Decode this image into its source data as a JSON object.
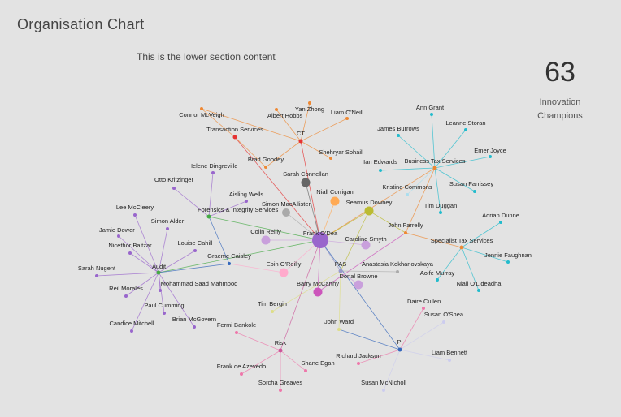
{
  "header": {
    "title": "Organisation Chart",
    "subtitle": "This is the lower section content"
  },
  "kpi": {
    "value": "63",
    "label_line1": "Innovation",
    "label_line2": "Champions"
  },
  "chart_data": {
    "type": "network",
    "nodes": [
      {
        "id": "frank",
        "label": "Frank O'Dea",
        "color": "#9966cc",
        "size": "hub"
      },
      {
        "id": "ct",
        "label": "CT",
        "color": "#e63333",
        "size": "group"
      },
      {
        "id": "ts",
        "label": "Transaction Services",
        "color": "#e63333",
        "size": "group"
      },
      {
        "id": "fis",
        "label": "Forensics & Integrity Services",
        "color": "#44aa44",
        "size": "group"
      },
      {
        "id": "audit",
        "label": "Audit",
        "color": "#44aa44",
        "size": "group"
      },
      {
        "id": "bts",
        "label": "Business Tax Services",
        "color": "#ee8833",
        "size": "group"
      },
      {
        "id": "sts",
        "label": "Specialist Tax Services",
        "color": "#ee8833",
        "size": "group"
      },
      {
        "id": "pas",
        "label": "PAS",
        "color": "#9999cc",
        "size": "group"
      },
      {
        "id": "risk",
        "label": "Risk",
        "color": "#cc5599",
        "size": "group"
      },
      {
        "id": "pi",
        "label": "PI",
        "color": "#3366bb",
        "size": "group"
      },
      {
        "id": "connor",
        "label": "Connor McVeigh",
        "color": "#ee8833"
      },
      {
        "id": "albert",
        "label": "Albert Hobbs",
        "color": "#ee8833"
      },
      {
        "id": "yan",
        "label": "Yan Zhong",
        "color": "#ee8833"
      },
      {
        "id": "liam",
        "label": "Liam O'Neill",
        "color": "#ee8833"
      },
      {
        "id": "shehryar",
        "label": "Shehryar Sohail",
        "color": "#ee8833"
      },
      {
        "id": "brad",
        "label": "Brad Goodey",
        "color": "#ee8833"
      },
      {
        "id": "sarah_c",
        "label": "Sarah Connellan",
        "color": "#666666"
      },
      {
        "id": "helene",
        "label": "Helene Dingreville",
        "color": "#9966cc"
      },
      {
        "id": "otto",
        "label": "Otto Kritzinger",
        "color": "#9966cc"
      },
      {
        "id": "aisling",
        "label": "Aisling Wells",
        "color": "#9966cc"
      },
      {
        "id": "simon_mac",
        "label": "Simon MacAllister",
        "color": "#aaaaaa"
      },
      {
        "id": "niall_c",
        "label": "Niall Corrigan",
        "color": "#ffaa55"
      },
      {
        "id": "seamus",
        "label": "Seamus Downey",
        "color": "#bbbb33"
      },
      {
        "id": "lee",
        "label": "Lee McCleery",
        "color": "#9966cc"
      },
      {
        "id": "simon_a",
        "label": "Simon Alder",
        "color": "#9966cc"
      },
      {
        "id": "jamie_d",
        "label": "Jamie Dower",
        "color": "#9966cc"
      },
      {
        "id": "nicethor",
        "label": "Nicethor Baltzar",
        "color": "#9966cc"
      },
      {
        "id": "louise",
        "label": "Louise Cahill",
        "color": "#9966cc"
      },
      {
        "id": "colin",
        "label": "Colin Reilly",
        "color": "#c9a0dc"
      },
      {
        "id": "caroline",
        "label": "Caroline Smyth",
        "color": "#c9a0dc"
      },
      {
        "id": "graeme",
        "label": "Graeme Caisley",
        "color": "#3366bb"
      },
      {
        "id": "sarah_n",
        "label": "Sarah Nugent",
        "color": "#9966cc"
      },
      {
        "id": "eoin",
        "label": "Eoin O'Reilly",
        "color": "#ffaacc"
      },
      {
        "id": "mohammad",
        "label": "Mohammad Saad Mahmood",
        "color": "#9966cc"
      },
      {
        "id": "reil",
        "label": "Reil Morales",
        "color": "#9966cc"
      },
      {
        "id": "anastasia",
        "label": "Anastasia Kokhanovskaya",
        "color": "#aaaaaa"
      },
      {
        "id": "donal",
        "label": "Donal Browne",
        "color": "#c9a0dc"
      },
      {
        "id": "barry",
        "label": "Barry McCarthy",
        "color": "#cc55bb"
      },
      {
        "id": "paul",
        "label": "Paul Cumming",
        "color": "#9966cc"
      },
      {
        "id": "tim_b",
        "label": "Tim Bergin",
        "color": "#dddd88"
      },
      {
        "id": "brian",
        "label": "Brian McGovern",
        "color": "#9966cc"
      },
      {
        "id": "candice",
        "label": "Candice Mitchell",
        "color": "#9966cc"
      },
      {
        "id": "fermi",
        "label": "Fermi Bankole",
        "color": "#ee77aa"
      },
      {
        "id": "john_w",
        "label": "John Ward",
        "color": "#dddd88"
      },
      {
        "id": "shane",
        "label": "Shane Egan",
        "color": "#ee77aa"
      },
      {
        "id": "frank_a",
        "label": "Frank de Azevedo",
        "color": "#ee77aa"
      },
      {
        "id": "sorcha",
        "label": "Sorcha Greaves",
        "color": "#ee77aa"
      },
      {
        "id": "richard",
        "label": "Richard Jackson",
        "color": "#ee77aa"
      },
      {
        "id": "susan_m",
        "label": "Susan McNicholl",
        "color": "#ccccee"
      },
      {
        "id": "daire",
        "label": "Daire Cullen",
        "color": "#ee77aa"
      },
      {
        "id": "susan_os",
        "label": "Susan O'Shea",
        "color": "#ccccee"
      },
      {
        "id": "liam_b",
        "label": "Liam Bennett",
        "color": "#ccccee"
      },
      {
        "id": "ann",
        "label": "Ann Grant",
        "color": "#22bbcc"
      },
      {
        "id": "leanne",
        "label": "Leanne Storan",
        "color": "#22bbcc"
      },
      {
        "id": "james",
        "label": "James Burrows",
        "color": "#22bbcc"
      },
      {
        "id": "emer",
        "label": "Emer Joyce",
        "color": "#22bbcc"
      },
      {
        "id": "ian",
        "label": "Ian Edwards",
        "color": "#22bbcc"
      },
      {
        "id": "susan_f",
        "label": "Susan Farrissey",
        "color": "#22bbcc"
      },
      {
        "id": "kristine",
        "label": "Kristine Commons",
        "color": "#aaddee"
      },
      {
        "id": "tim_d",
        "label": "Tim Duggan",
        "color": "#22bbcc"
      },
      {
        "id": "john_f",
        "label": "John Farrelly",
        "color": "#ee8833"
      },
      {
        "id": "adrian",
        "label": "Adrian Dunne",
        "color": "#22bbcc"
      },
      {
        "id": "jennie",
        "label": "Jennie Faughnan",
        "color": "#22bbcc"
      },
      {
        "id": "aoife",
        "label": "Aoife Murray",
        "color": "#22bbcc"
      },
      {
        "id": "niall_ol",
        "label": "Niall O'Lideadha",
        "color": "#22bbcc"
      }
    ],
    "edges": [
      [
        "frank",
        "ct"
      ],
      [
        "frank",
        "ts"
      ],
      [
        "frank",
        "fis"
      ],
      [
        "frank",
        "audit"
      ],
      [
        "frank",
        "bts"
      ],
      [
        "frank",
        "pas"
      ],
      [
        "frank",
        "risk"
      ],
      [
        "frank",
        "pi"
      ],
      [
        "frank",
        "sarah_c"
      ],
      [
        "frank",
        "simon_mac"
      ],
      [
        "frank",
        "niall_c"
      ],
      [
        "frank",
        "seamus"
      ],
      [
        "frank",
        "colin"
      ],
      [
        "frank",
        "caroline"
      ],
      [
        "frank",
        "eoin"
      ],
      [
        "frank",
        "barry"
      ],
      [
        "ct",
        "albert"
      ],
      [
        "ct",
        "yan"
      ],
      [
        "ct",
        "liam"
      ],
      [
        "ct",
        "shehryar"
      ],
      [
        "ct",
        "brad"
      ],
      [
        "ct",
        "connor"
      ],
      [
        "ts",
        "connor"
      ],
      [
        "ts",
        "brad"
      ],
      [
        "fis",
        "helene"
      ],
      [
        "fis",
        "otto"
      ],
      [
        "fis",
        "aisling"
      ],
      [
        "fis",
        "graeme"
      ],
      [
        "audit",
        "lee"
      ],
      [
        "audit",
        "simon_a"
      ],
      [
        "audit",
        "jamie_d"
      ],
      [
        "audit",
        "nicethor"
      ],
      [
        "audit",
        "louise"
      ],
      [
        "audit",
        "sarah_n"
      ],
      [
        "audit",
        "mohammad"
      ],
      [
        "audit",
        "reil"
      ],
      [
        "audit",
        "paul"
      ],
      [
        "audit",
        "brian"
      ],
      [
        "audit",
        "candice"
      ],
      [
        "audit",
        "graeme"
      ],
      [
        "graeme",
        "eoin"
      ],
      [
        "bts",
        "ann"
      ],
      [
        "bts",
        "leanne"
      ],
      [
        "bts",
        "james"
      ],
      [
        "bts",
        "emer"
      ],
      [
        "bts",
        "ian"
      ],
      [
        "bts",
        "susan_f"
      ],
      [
        "bts",
        "kristine"
      ],
      [
        "bts",
        "tim_d"
      ],
      [
        "bts",
        "john_f"
      ],
      [
        "john_f",
        "sts"
      ],
      [
        "john_f",
        "seamus"
      ],
      [
        "john_f",
        "barry"
      ],
      [
        "sts",
        "adrian"
      ],
      [
        "sts",
        "jennie"
      ],
      [
        "sts",
        "aoife"
      ],
      [
        "sts",
        "niall_ol"
      ],
      [
        "pas",
        "anastasia"
      ],
      [
        "pas",
        "donal"
      ],
      [
        "pas",
        "tim_b"
      ],
      [
        "pas",
        "john_w"
      ],
      [
        "pas",
        "seamus"
      ],
      [
        "john_w",
        "pi"
      ],
      [
        "risk",
        "fermi"
      ],
      [
        "risk",
        "shane"
      ],
      [
        "risk",
        "frank_a"
      ],
      [
        "risk",
        "sorcha"
      ],
      [
        "pi",
        "richard"
      ],
      [
        "pi",
        "susan_m"
      ],
      [
        "pi",
        "daire"
      ],
      [
        "pi",
        "susan_os"
      ],
      [
        "pi",
        "liam_b"
      ]
    ]
  }
}
